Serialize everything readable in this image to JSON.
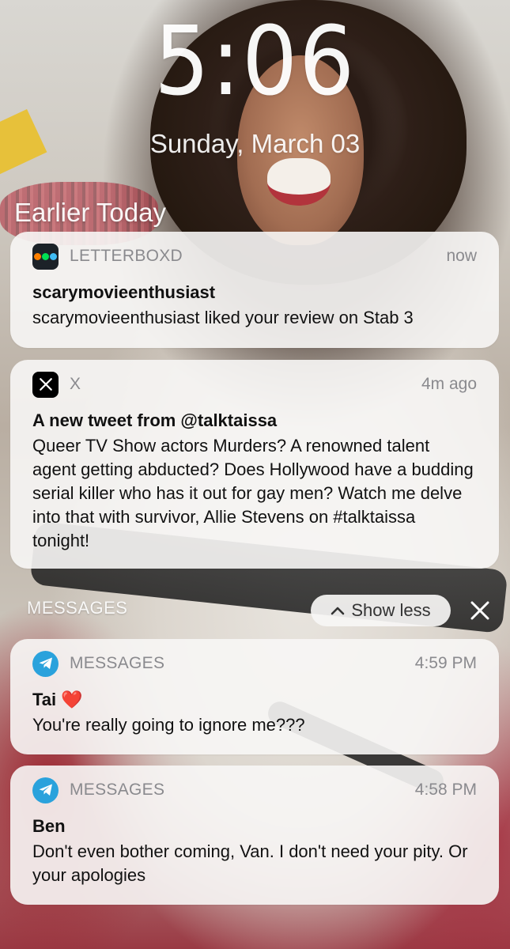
{
  "lockscreen": {
    "time": "5:06",
    "date": "Sunday, March 03",
    "section_title": "Earlier Today"
  },
  "notifications": [
    {
      "app": "LETTERBOXD",
      "icon": "letterboxd-icon",
      "time": "now",
      "title": "scarymovieenthusiast",
      "body": "scarymovieenthusiast liked your review on Stab 3"
    },
    {
      "app": "X",
      "icon": "x-icon",
      "time": "4m ago",
      "title": "A new tweet from @talktaissa",
      "body": "Queer TV Show actors Murders? A renowned talent agent getting abducted? Does Hollywood have a budding serial killer who has it out for gay men? Watch me delve into that with survivor, Allie Stevens on #talktaissa tonight!"
    }
  ],
  "messages_group": {
    "label": "MESSAGES",
    "show_less_label": "Show less",
    "items": [
      {
        "app": "MESSAGES",
        "icon": "telegram-icon",
        "time": "4:59 PM",
        "title": "Tai ❤️",
        "body": "You're really going to ignore me???"
      },
      {
        "app": "MESSAGES",
        "icon": "telegram-icon",
        "time": "4:58 PM",
        "title": "Ben",
        "body": "Don't even bother coming, Van. I don't need your pity. Or your apologies"
      }
    ]
  },
  "colors": {
    "card_bg": "#f7f6f5",
    "secondary_text": "#8a8a8e",
    "telegram_blue": "#2aa2dc",
    "letterboxd_orange": "#ff8000",
    "letterboxd_green": "#00e054",
    "letterboxd_blue": "#40bcf4"
  }
}
